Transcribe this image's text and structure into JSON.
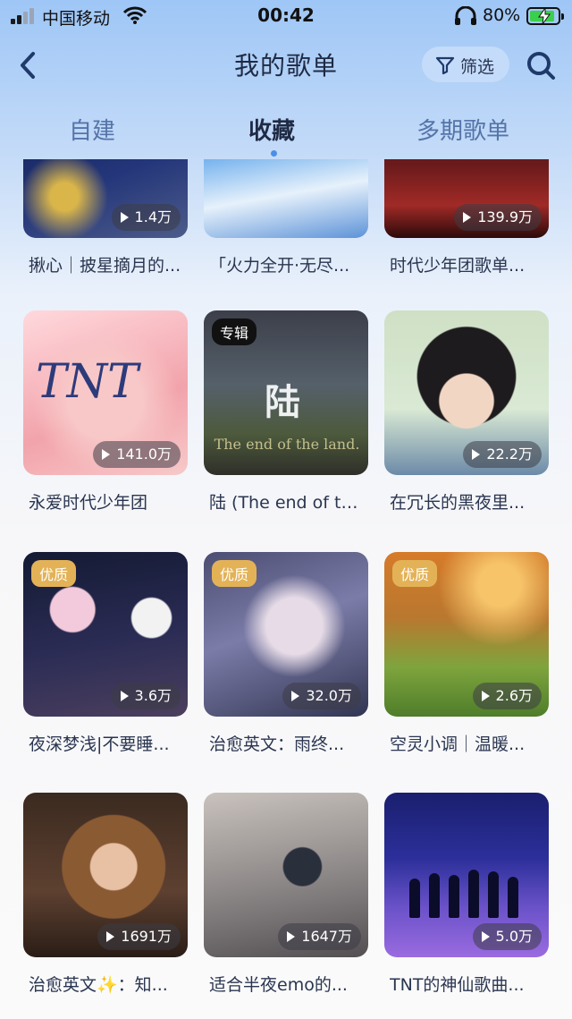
{
  "status_bar": {
    "carrier": "中国移动",
    "time": "00:42",
    "battery_pct": "80%",
    "battery_level": 0.8
  },
  "nav": {
    "title": "我的歌单",
    "filter_label": "筛选"
  },
  "tabs": [
    {
      "label": "自建",
      "active": false
    },
    {
      "label": "收藏",
      "active": true
    },
    {
      "label": "多期歌单",
      "active": false
    }
  ],
  "playlists": [
    {
      "name": "揪心｜披星摘月的...",
      "plays": "1.4万",
      "badge": ""
    },
    {
      "name": "「火力全开·无尽...",
      "plays": "",
      "badge": ""
    },
    {
      "name": "时代少年团歌单...",
      "plays": "139.9万",
      "badge": ""
    },
    {
      "name": "永爱时代少年团",
      "plays": "141.0万",
      "badge": ""
    },
    {
      "name": "陆 (The end of the...",
      "plays": "",
      "badge": "专辑",
      "cover_title": "陆",
      "cover_subtitle": "The end of the land."
    },
    {
      "name": "在冗长的黑夜里...",
      "plays": "22.2万",
      "badge": ""
    },
    {
      "name": "夜深梦浅|不要睡...",
      "plays": "3.6万",
      "badge": "优质"
    },
    {
      "name": "治愈英文：雨终...",
      "plays": "32.0万",
      "badge": "优质"
    },
    {
      "name": "空灵小调｜温暖...",
      "plays": "2.6万",
      "badge": "优质"
    },
    {
      "name": "治愈英文✨：知...",
      "plays": "1691万",
      "badge": ""
    },
    {
      "name": "适合半夜emo的...",
      "plays": "1647万",
      "badge": ""
    },
    {
      "name": "TNT的神仙歌曲...",
      "plays": "5.0万",
      "badge": ""
    }
  ],
  "colors": {
    "accent": "#4a8fe8",
    "premium_badge": "#e3b257"
  }
}
